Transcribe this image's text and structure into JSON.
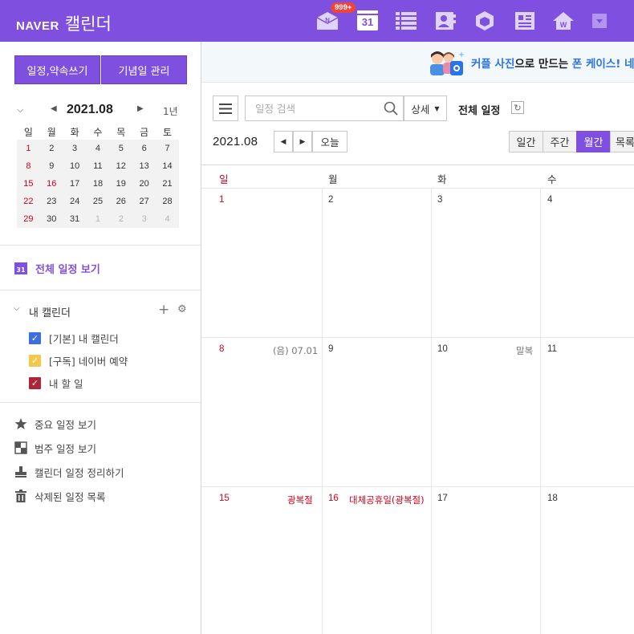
{
  "header": {
    "logo_brand": "NAVER",
    "logo_title": "캘린더",
    "mail_badge": "999+",
    "calendar_icon_number": "31"
  },
  "sidebar": {
    "write_button": "일정,약속쓰기",
    "anniversary_button": "기념일 관리",
    "mini_calendar": {
      "title": "2021.08",
      "year_toggle": "1년",
      "weekdays": [
        "일",
        "월",
        "화",
        "수",
        "목",
        "금",
        "토"
      ],
      "weeks": [
        [
          "1",
          "2",
          "3",
          "4",
          "5",
          "6",
          "7"
        ],
        [
          "8",
          "9",
          "10",
          "11",
          "12",
          "13",
          "14"
        ],
        [
          "15",
          "16",
          "17",
          "18",
          "19",
          "20",
          "21"
        ],
        [
          "22",
          "23",
          "24",
          "25",
          "26",
          "27",
          "28"
        ],
        [
          "29",
          "30",
          "31",
          "1",
          "2",
          "3",
          "4"
        ]
      ]
    },
    "all_view_label": "전체 일정 보기",
    "all_view_icon_number": "31",
    "my_calendar_label": "내 캘린더",
    "calendars": [
      {
        "label": "[기본] 내 캘린더",
        "color": "#3b6fe0"
      },
      {
        "label": "[구독] 네이버 예약",
        "color": "#f5c84c"
      },
      {
        "label": "내 할 일",
        "color": "#b0243a"
      }
    ],
    "tools": [
      {
        "label": "중요 일정 보기",
        "icon": "star-icon"
      },
      {
        "label": "범주 일정 보기",
        "icon": "category-grid-icon"
      },
      {
        "label": "캘린더 일정 정리하기",
        "icon": "stamp-icon"
      },
      {
        "label": "삭제된 일정 목록",
        "icon": "trash-icon"
      }
    ]
  },
  "main": {
    "banner": {
      "part1": "커플 사진",
      "part2": "으로 만드는 ",
      "part3": "폰 케이스",
      "part4": "! 네"
    },
    "search_placeholder": "일정 검색",
    "detail_button": "상세",
    "all_schedule_label": "전체 일정",
    "current_month": "2021.08",
    "today_button": "오늘",
    "view_tabs": [
      "일간",
      "주간",
      "월간",
      "목록"
    ],
    "active_view": "월간",
    "day_headers": [
      "일",
      "월",
      "화",
      "수"
    ],
    "weeks": [
      {
        "days": [
          "1",
          "2",
          "3",
          "4"
        ],
        "events": {}
      },
      {
        "days": [
          "8",
          "9",
          "10",
          "11"
        ],
        "events": {
          "sun": "(음) 07.01",
          "tue": "말복"
        }
      },
      {
        "days": [
          "15",
          "16",
          "17",
          "18"
        ],
        "events": {
          "sun": "광복절",
          "mon": "대체공휴일(광복절)"
        }
      }
    ]
  },
  "colors": {
    "brand_purple": "#7f4fe0",
    "holiday_red": "#d0021b"
  }
}
